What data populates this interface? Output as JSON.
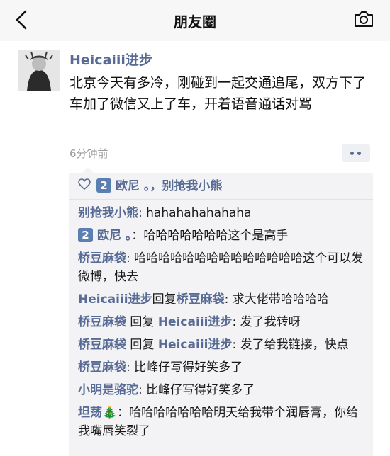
{
  "nav": {
    "title": "朋友圈",
    "back_icon": "chevron-left-icon",
    "camera_icon": "camera-icon"
  },
  "post": {
    "author": "Heicaiii进步",
    "content": "北京今天有多冷，刚碰到一起交通追尾，双方下了车加了微信又上了车，开着语音通话对骂",
    "time": "6分钟前"
  },
  "likes": {
    "badge": "2",
    "liker1": "欧尼 。",
    "separator": "，",
    "liker2": "别抢我小熊"
  },
  "comments": [
    {
      "author": "别抢我小熊",
      "sep": ": ",
      "text": "hahahahahahaha"
    },
    {
      "badge": "2",
      "author": "欧尼 。",
      "sep": "：",
      "text": "哈哈哈哈哈哈哈这个是高手"
    },
    {
      "author": "桥豆麻袋",
      "sep": ": ",
      "text": "哈哈哈哈哈哈哈哈哈哈哈哈哈哈这个可以发微博，快去"
    },
    {
      "author": "Heicaiii进步",
      "reply_word": "回复",
      "reply_to": "桥豆麻袋",
      "sep": ": ",
      "text": "求大佬带哈哈哈哈"
    },
    {
      "author": "桥豆麻袋",
      "reply_word": "回复",
      "reply_to": "Heicaiii进步",
      "sep": ": ",
      "text": "发了我转呀"
    },
    {
      "author": "桥豆麻袋",
      "reply_word": "回复",
      "reply_to": "Heicaiii进步",
      "sep": ": ",
      "text": "发了给我链接，快点"
    },
    {
      "author": "桥豆麻袋",
      "sep": ": ",
      "text": "比峰仔写得好笑多了"
    },
    {
      "author": "小明是骆驼",
      "sep": ": ",
      "text": "比峰仔写得好笑多了"
    },
    {
      "author": "坦荡",
      "emoji": "🎄",
      "sep": "：",
      "text": "哈哈哈哈哈哈哈明天给我带个润唇膏，你给我嘴唇笑裂了"
    }
  ],
  "colors": {
    "name_blue": "#576b95",
    "panel_bg": "#f3f3f5",
    "nav_bg": "#f7f7f7"
  }
}
